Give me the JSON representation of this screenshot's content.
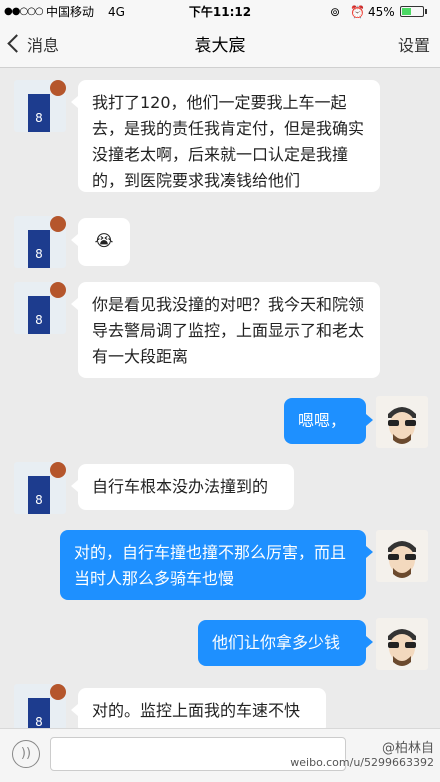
{
  "status_bar": {
    "signal": "●●○○○",
    "carrier": "中国移动",
    "network": "4G",
    "time": "下午11:12",
    "battery": "45%",
    "battery_level": 0.45
  },
  "nav": {
    "back_label": "消息",
    "title": "袁大宸",
    "settings_label": "设置"
  },
  "messages": [
    {
      "from": "them",
      "text": "我打了120，他们一定要我上车一起去，是我的责任我肯定付，但是我确实没撞老太啊，后来就一口认定是我撞的，到医院要求我凑钱给他们"
    },
    {
      "from": "them",
      "text": "😭"
    },
    {
      "from": "them",
      "text": "你是看见我没撞的对吧？我今天和院领导去警局调了监控，上面显示了和老太有一大段距离"
    },
    {
      "from": "me",
      "text": "嗯嗯，"
    },
    {
      "from": "them",
      "text": "自行车根本没办法撞到的"
    },
    {
      "from": "me",
      "text": "对的，自行车撞也撞不那么厉害，而且当时人那么多骑车也慢"
    },
    {
      "from": "me",
      "text": "他们让你拿多少钱"
    },
    {
      "from": "them",
      "text": "对的。监控上面我的车速不快"
    }
  ],
  "input": {
    "placeholder": ""
  },
  "watermark": {
    "user": "@柏林自",
    "url": "weibo.com/u/5299663392"
  },
  "colors": {
    "outgoing_bubble": "#1e90ff",
    "incoming_bubble": "#ffffff",
    "background": "#ebebeb"
  }
}
